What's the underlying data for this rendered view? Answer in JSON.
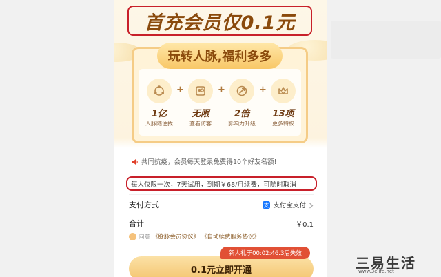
{
  "hero": {
    "title": "首充会员仅0.1元"
  },
  "card": {
    "badge": "玩转人脉,福利多多",
    "benefits": [
      {
        "icon": "network-icon",
        "value": "1亿",
        "label": "人脉随便找"
      },
      {
        "icon": "visitors-icon",
        "value": "无限",
        "label": "查看访客"
      },
      {
        "icon": "growth-icon",
        "value": "2倍",
        "label": "影响力升级"
      },
      {
        "icon": "crown-icon",
        "value": "13项",
        "label": "更多特权"
      }
    ]
  },
  "notice": {
    "icon": "speaker-icon",
    "text": "共同抗疫，会员每天登录免费得10个好友名额!"
  },
  "rule": {
    "text": "每人仅限一次，7天试用，到期￥68/月续费，可随时取消"
  },
  "payment": {
    "label": "支付方式",
    "method": "支付宝支付",
    "icon": "alipay-icon"
  },
  "total": {
    "label": "合计",
    "amount": "￥0.1"
  },
  "agreement": {
    "prefix": "同意",
    "link1": "《脉脉会员协议》",
    "link2": "《自动续费服务协议》"
  },
  "timer": {
    "text": "新人礼于00:02:46.3后失效"
  },
  "button": {
    "label": "0.1元立即开通"
  },
  "watermark": {
    "text": "三易生活",
    "url": "www.3elife.net"
  },
  "colors": {
    "accent": "#f4c46e",
    "highlight": "#c8202a",
    "brand_brown": "#8a4a0c",
    "alipay": "#1677ff"
  }
}
